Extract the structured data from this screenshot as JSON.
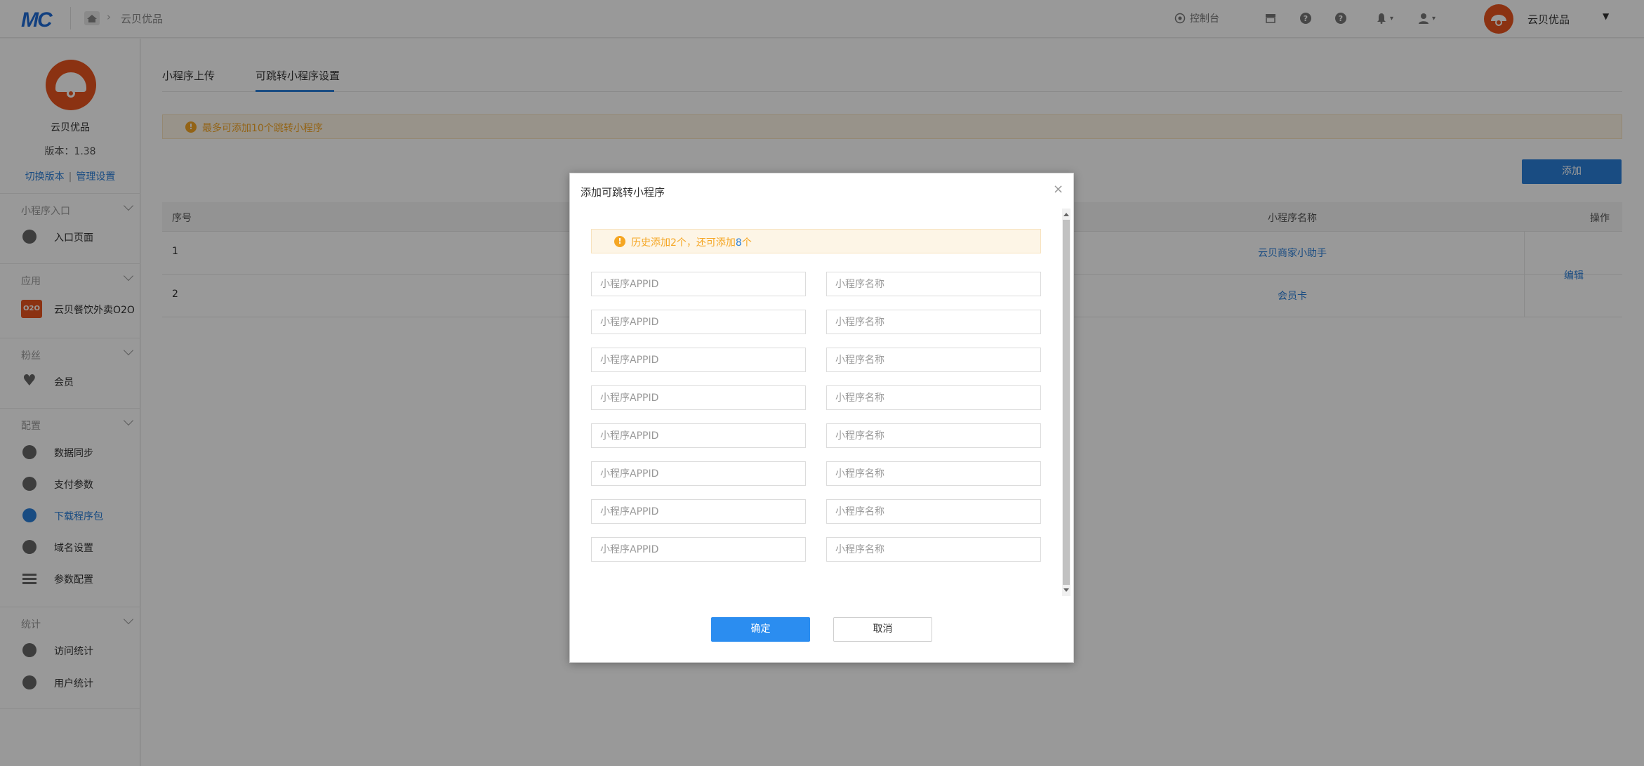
{
  "topbar": {
    "logo": "MC",
    "breadcrumb_current": "云贝优品",
    "console_label": "控制台",
    "user_name": "云贝优品"
  },
  "sidebar": {
    "app_name": "云贝优品",
    "version_label": "版本：1.38",
    "switch_version": "切换版本",
    "link_separator": "|",
    "manage_settings": "管理设置",
    "groups": [
      {
        "label": "小程序入口",
        "items": [
          {
            "label": "入口页面",
            "icon": "link-icon"
          }
        ]
      },
      {
        "label": "应用",
        "items": [
          {
            "label": "云贝餐饮外卖O2O",
            "icon": "o2o-app-icon",
            "icon_text": "O2O"
          }
        ]
      },
      {
        "label": "粉丝",
        "items": [
          {
            "label": "会员",
            "icon": "heart-icon"
          }
        ]
      },
      {
        "label": "配置",
        "items": [
          {
            "label": "数据同步",
            "icon": "link-icon"
          },
          {
            "label": "支付参数",
            "icon": "gear-icon"
          },
          {
            "label": "下载程序包",
            "icon": "shield-icon",
            "active": true
          },
          {
            "label": "域名设置",
            "icon": "shield-icon"
          },
          {
            "label": "参数配置",
            "icon": "list-icon"
          }
        ]
      },
      {
        "label": "统计",
        "items": [
          {
            "label": "访问统计",
            "icon": "chart-icon"
          },
          {
            "label": "用户统计",
            "icon": "chart-icon"
          }
        ]
      }
    ]
  },
  "main": {
    "tabs": [
      {
        "label": "小程序上传",
        "active": false
      },
      {
        "label": "可跳转小程序设置",
        "active": true
      }
    ],
    "notice": "最多可添加10个跳转小程序",
    "add_button": "添加",
    "table": {
      "headers": {
        "index": "序号",
        "name": "小程序名称",
        "ops": "操作"
      },
      "rows": [
        {
          "index": "1",
          "name": "云贝商家小助手"
        },
        {
          "index": "2",
          "name": "会员卡"
        }
      ],
      "edit_label": "编辑"
    }
  },
  "modal": {
    "title": "添加可跳转小程序",
    "close_symbol": "×",
    "notice_prefix": "历史添加2个，还可添加",
    "notice_count": "8",
    "notice_suffix": "个",
    "appid_placeholder": "小程序APPID",
    "name_placeholder": "小程序名称",
    "confirm_button": "确定",
    "cancel_button": "取消"
  },
  "colors": {
    "accent": "#2b7fd9",
    "brand_orange": "#e8541e",
    "warning": "#f5a623"
  }
}
